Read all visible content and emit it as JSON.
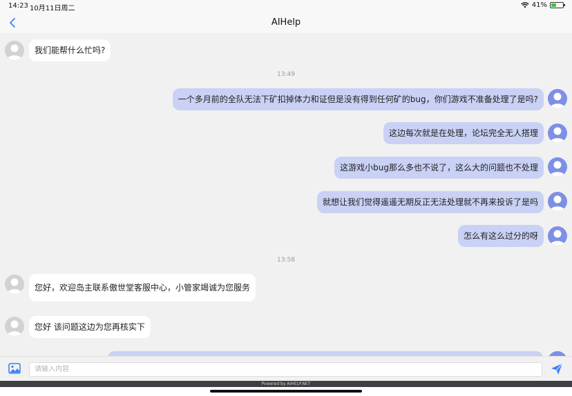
{
  "status": {
    "time": "14:23",
    "date": "10月11日周二",
    "battery": "41%",
    "battery_level": 0.41,
    "colors": {
      "battery_fill": "#3cc43c"
    }
  },
  "nav": {
    "title": "AIHelp",
    "back_icon": "chevron-left-icon"
  },
  "chat": {
    "timestamps": [
      "13:49",
      "13:58"
    ],
    "messages": [
      {
        "sender": "agent",
        "text": "我们能帮什么忙吗?"
      },
      {
        "sender": "user",
        "text": "一个多月前的全队无法下矿扣掉体力和证但是没有得到任何矿的bug，你们游戏不准备处理了是吗?"
      },
      {
        "sender": "user",
        "text": "这边每次就是在处理，论坛完全无人搭理"
      },
      {
        "sender": "user",
        "text": "这游戏小bug那么多也不说了，这么大的问题也不处理"
      },
      {
        "sender": "user",
        "text": "就想让我们觉得遥遥无期反正无法处理就不再来投诉了是吗"
      },
      {
        "sender": "user",
        "text": "怎么有这么过分的呀"
      },
      {
        "sender": "agent",
        "text": "您好，欢迎岛主联系傲世堂客服中心，小管家竭诚为您服务"
      },
      {
        "sender": "agent",
        "text": "您好 该问题这边为您再核实下"
      }
    ]
  },
  "composer": {
    "placeholder": "请输入内容",
    "image_icon": "image-icon",
    "send_icon": "send-icon"
  },
  "footer": {
    "powered_by": "Powered by AIHELP.NET"
  },
  "colors": {
    "user_bubble": "#c9d1f5",
    "agent_bubble": "#ffffff",
    "user_avatar": "#7e8fe6",
    "agent_avatar": "#d2d2d2",
    "accent": "#3b82f6"
  }
}
